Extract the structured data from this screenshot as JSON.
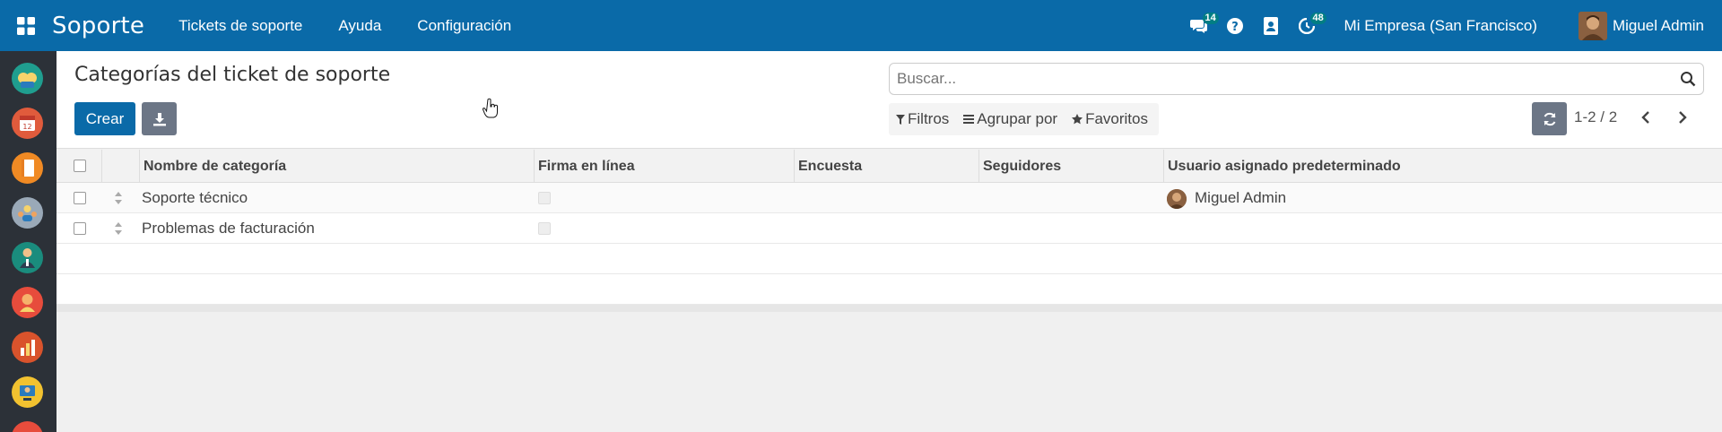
{
  "navbar": {
    "app_name": "Soporte",
    "menus": [
      "Tickets de soporte",
      "Ayuda",
      "Configuración"
    ],
    "messages_count": "14",
    "activities_count": "48",
    "company": "Mi Empresa (San Francisco)",
    "user_name": "Miguel Admin",
    "colors": {
      "bar": "#0a6aa8",
      "badge": "#017e84"
    }
  },
  "page": {
    "title": "Categorías del ticket de soporte",
    "create_label": "Crear",
    "search_placeholder": "Buscar...",
    "filters_label": "Filtros",
    "group_by_label": "Agrupar por",
    "favorites_label": "Favoritos",
    "pager": "1-2 / 2"
  },
  "table": {
    "columns": [
      "Nombre de categoría",
      "Firma en línea",
      "Encuesta",
      "Seguidores",
      "Usuario asignado predeterminado"
    ],
    "rows": [
      {
        "name": "Soporte técnico",
        "assigned_user": "Miguel Admin"
      },
      {
        "name": "Problemas de facturación",
        "assigned_user": ""
      }
    ]
  },
  "sidebar": {
    "icons": [
      "tickets-app-icon",
      "calendar-app-icon",
      "notes-app-icon",
      "team-app-icon",
      "employee-app-icon",
      "helpdesk-app-icon",
      "reporting-app-icon",
      "support-agent-app-icon",
      "extra-app-icon"
    ]
  }
}
